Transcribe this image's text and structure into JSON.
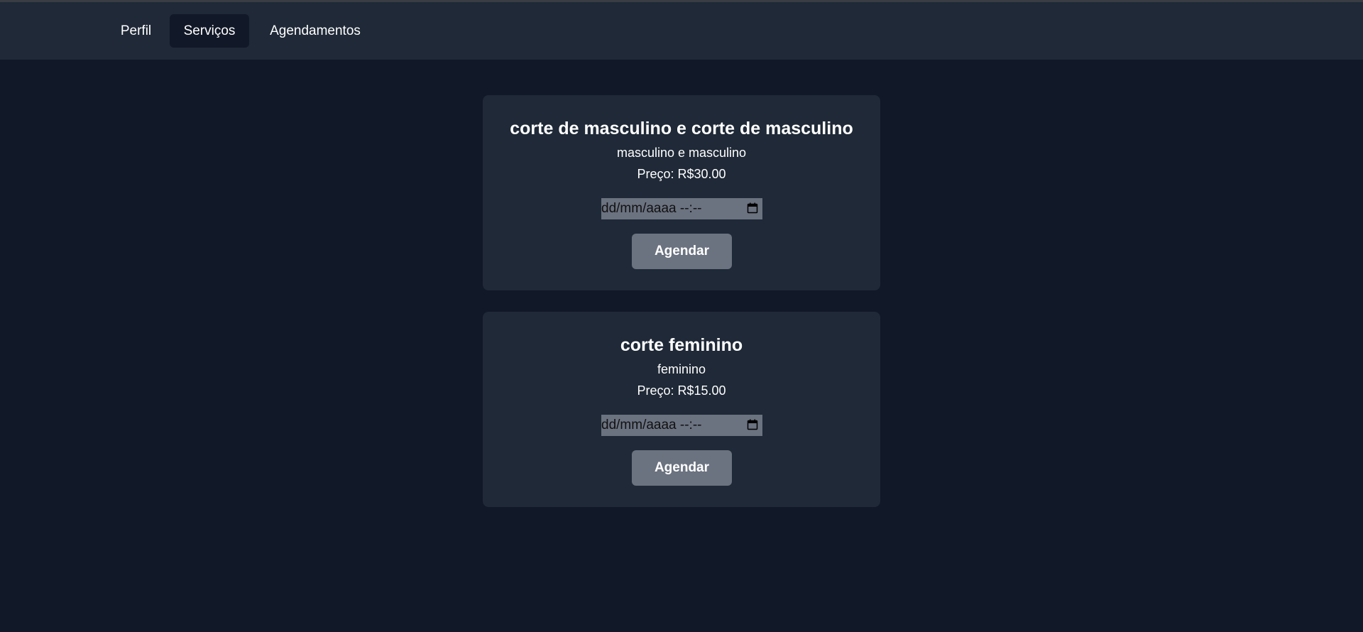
{
  "nav": {
    "items": [
      {
        "label": "Perfil",
        "active": false
      },
      {
        "label": "Serviços",
        "active": true
      },
      {
        "label": "Agendamentos",
        "active": false
      }
    ]
  },
  "services": [
    {
      "title": "corte de masculino e corte de masculino",
      "description": "masculino e masculino",
      "price": "Preço: R$30.00",
      "date_placeholder": "dd/mm/aaaa --:--",
      "button_label": "Agendar"
    },
    {
      "title": "corte feminino",
      "description": "feminino",
      "price": "Preço: R$15.00",
      "date_placeholder": "dd/mm/aaaa --:--",
      "button_label": "Agendar"
    }
  ],
  "colors": {
    "page_bg": "#111827",
    "navbar_bg": "#1f2937",
    "card_bg": "#1f2937",
    "button_bg": "#6b7280",
    "input_bg": "#6b7280",
    "text": "#ffffff"
  },
  "icons": {
    "date_picker": "calendar-icon"
  }
}
